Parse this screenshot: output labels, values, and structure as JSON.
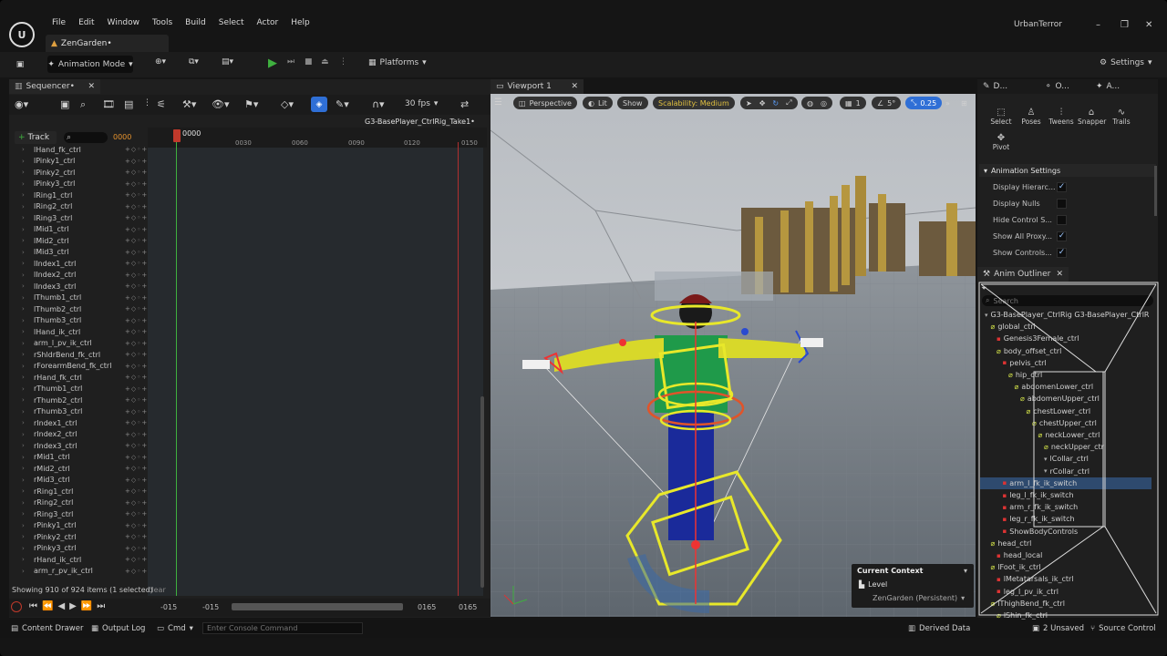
{
  "app": {
    "project": "UrbanTerror",
    "doc_tab": "ZenGarden•",
    "menu": [
      "File",
      "Edit",
      "Window",
      "Tools",
      "Build",
      "Select",
      "Actor",
      "Help"
    ]
  },
  "toolbar": {
    "mode": "Animation Mode",
    "platforms": "Platforms",
    "settings": "Settings"
  },
  "sequencer": {
    "title": "Sequencer•",
    "fps": "30 fps",
    "take": "G3-BasePlayer_CtrlRig_Take1•",
    "track_btn": "Track",
    "frame": "0000",
    "playhead": "0000",
    "ruler": [
      "0030",
      "0060",
      "0090",
      "0120",
      "0150"
    ],
    "tracks": [
      "lHand_fk_ctrl",
      "lPinky1_ctrl",
      "lPinky2_ctrl",
      "lPinky3_ctrl",
      "lRing1_ctrl",
      "lRing2_ctrl",
      "lRing3_ctrl",
      "lMid1_ctrl",
      "lMid2_ctrl",
      "lMid3_ctrl",
      "lIndex1_ctrl",
      "lIndex2_ctrl",
      "lIndex3_ctrl",
      "lThumb1_ctrl",
      "lThumb2_ctrl",
      "lThumb3_ctrl",
      "lHand_ik_ctrl",
      "arm_l_pv_ik_ctrl",
      "rShldrBend_fk_ctrl",
      "rForearmBend_fk_ctrl",
      "rHand_fk_ctrl",
      "rThumb1_ctrl",
      "rThumb2_ctrl",
      "rThumb3_ctrl",
      "rIndex1_ctrl",
      "rIndex2_ctrl",
      "rIndex3_ctrl",
      "rMid1_ctrl",
      "rMid2_ctrl",
      "rMid3_ctrl",
      "rRing1_ctrl",
      "rRing2_ctrl",
      "rRing3_ctrl",
      "rPinky1_ctrl",
      "rPinky2_ctrl",
      "rPinky3_ctrl",
      "rHand_ik_ctrl",
      "arm_r_pv_ik_ctrl"
    ],
    "status": "Showing 910 of 924 items (1 selected)",
    "clear": "clear",
    "range": {
      "a": "-015",
      "b": "-015",
      "c": "0165",
      "d": "0165"
    }
  },
  "viewport": {
    "title": "Viewport 1",
    "perspective": "Perspective",
    "lit": "Lit",
    "show": "Show",
    "scalability": "Scalability: Medium",
    "grid_val": "1",
    "angle_val": "5°",
    "scale_val": "0.25",
    "context": {
      "title": "Current Context",
      "level_label": "Level",
      "level_value": "ZenGarden (Persistent)"
    }
  },
  "right_panel": {
    "tabs": [
      "D...",
      "O...",
      "A..."
    ],
    "tools": [
      "Select",
      "Poses",
      "Tweens",
      "Snapper",
      "Trails",
      "Pivot"
    ],
    "section": "Animation Settings",
    "settings": [
      {
        "label": "Display Hierarc...",
        "checked": "✓"
      },
      {
        "label": "Display Nulls",
        "checked": ""
      },
      {
        "label": "Hide Control S...",
        "checked": ""
      },
      {
        "label": "Show All Proxy...",
        "checked": "✓"
      },
      {
        "label": "Show Controls...",
        "checked": "✓"
      }
    ]
  },
  "outliner": {
    "title": "Anim Outliner",
    "search": "Search",
    "rows": [
      {
        "t": "G3-BasePlayer_CtrlRig G3-BasePlayer_CtrlR",
        "i": 0,
        "k": "n"
      },
      {
        "t": "global_ctrl",
        "i": 1,
        "k": "g"
      },
      {
        "t": "Genesis3Female_ctrl",
        "i": 2,
        "k": "r"
      },
      {
        "t": "body_offset_ctrl",
        "i": 2,
        "k": "g"
      },
      {
        "t": "pelvis_ctrl",
        "i": 3,
        "k": "r"
      },
      {
        "t": "hip_ctrl",
        "i": 4,
        "k": "g"
      },
      {
        "t": "abdomenLower_ctrl",
        "i": 5,
        "k": "g"
      },
      {
        "t": "abdomenUpper_ctrl",
        "i": 6,
        "k": "g"
      },
      {
        "t": "chestLower_ctrl",
        "i": 7,
        "k": "g"
      },
      {
        "t": "chestUpper_ctrl",
        "i": 8,
        "k": "g"
      },
      {
        "t": "neckLower_ctrl",
        "i": 9,
        "k": "g"
      },
      {
        "t": "neckUpper_ctrl",
        "i": 10,
        "k": "g"
      },
      {
        "t": "lCollar_ctrl",
        "i": 10,
        "k": "n"
      },
      {
        "t": "rCollar_ctrl",
        "i": 10,
        "k": "n"
      },
      {
        "t": "arm_l_fk_ik_switch",
        "i": 3,
        "k": "r"
      },
      {
        "t": "leg_l_fk_ik_switch",
        "i": 3,
        "k": "r"
      },
      {
        "t": "arm_r_fk_ik_switch",
        "i": 3,
        "k": "r"
      },
      {
        "t": "leg_r_fk_ik_switch",
        "i": 3,
        "k": "r"
      },
      {
        "t": "ShowBodyControls",
        "i": 3,
        "k": "r"
      },
      {
        "t": "head_ctrl",
        "i": 1,
        "k": "g"
      },
      {
        "t": "head_local",
        "i": 2,
        "k": "r"
      },
      {
        "t": "lFoot_ik_ctrl",
        "i": 1,
        "k": "g"
      },
      {
        "t": "lMetatarsals_ik_ctrl",
        "i": 2,
        "k": "r"
      },
      {
        "t": "leg_l_pv_ik_ctrl",
        "i": 2,
        "k": "r"
      },
      {
        "t": "lThighBend_fk_ctrl",
        "i": 1,
        "k": "g"
      },
      {
        "t": "lShin_fk_ctrl",
        "i": 2,
        "k": "g"
      }
    ]
  },
  "statusbar": {
    "content_drawer": "Content Drawer",
    "output_log": "Output Log",
    "cmd": "Cmd",
    "console_placeholder": "Enter Console Command",
    "derived": "Derived Data",
    "unsaved": "2 Unsaved",
    "source": "Source Control"
  },
  "colors": {
    "accent": "#2f6fd6",
    "selected_row": "#2e4a6e",
    "rig_yellow": "#e8e82a",
    "play_green": "#3fb03f"
  }
}
